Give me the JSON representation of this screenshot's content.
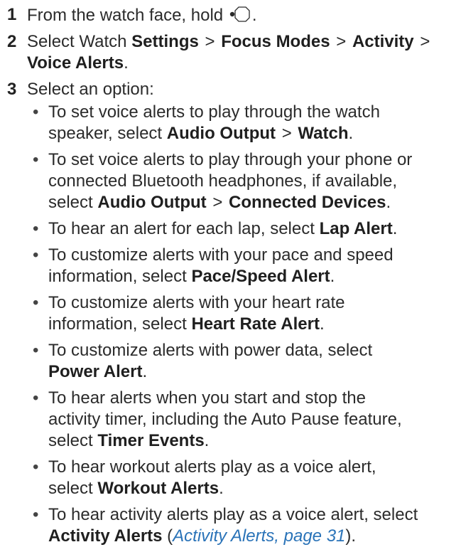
{
  "steps": [
    {
      "number": "1",
      "pre": "From the watch face, hold",
      "icon": "watch-button-icon",
      "post": "."
    },
    {
      "number": "2",
      "pre": "Select Watch",
      "settings": "Settings",
      "sep1": ">",
      "focus": "Focus Modes",
      "sep2": ">",
      "activity": "Activity",
      "sep3": ">",
      "voice": "Voice Alerts",
      "post": "."
    },
    {
      "number": "3",
      "text": "Select an option:"
    }
  ],
  "options": [
    {
      "line1": "To set voice alerts to play through the watch",
      "line2_pre": "speaker, select",
      "b1": "Audio Output",
      "sep": ">",
      "b2": "Watch",
      "post": "."
    },
    {
      "line1": "To set voice alerts to play through your phone or",
      "line2": "connected Bluetooth headphones, if available,",
      "line3_pre": "select",
      "b1": "Audio Output",
      "sep": ">",
      "b2": "Connected Devices",
      "post": "."
    },
    {
      "pre": "To hear an alert for each lap, select",
      "b1": "Lap Alert",
      "post": "."
    },
    {
      "line1": "To customize alerts with your pace and speed",
      "line2_pre": "information, select",
      "b1": "Pace/Speed Alert",
      "post": "."
    },
    {
      "line1": "To customize alerts with your heart rate",
      "line2_pre": "information, select",
      "b1": "Heart Rate Alert",
      "post": "."
    },
    {
      "line1": "To customize alerts with power data, select",
      "b1": "Power Alert",
      "post": "."
    },
    {
      "line1": "To hear alerts when you start and stop the",
      "line2": "activity timer, including the Auto Pause feature,",
      "line3_pre": "select",
      "b1": "Timer Events",
      "post": "."
    },
    {
      "line1": "To hear workout alerts play as a voice alert,",
      "line2_pre": "select",
      "b1": "Workout Alerts",
      "post": "."
    },
    {
      "line1": "To hear activity alerts play as a voice alert, select",
      "b1": "Activity Alerts",
      "open": "(",
      "xref": "Activity Alerts, page 31",
      "close": ")."
    }
  ],
  "colors": {
    "text": "#2b2b2b",
    "link": "#2a73b8"
  }
}
